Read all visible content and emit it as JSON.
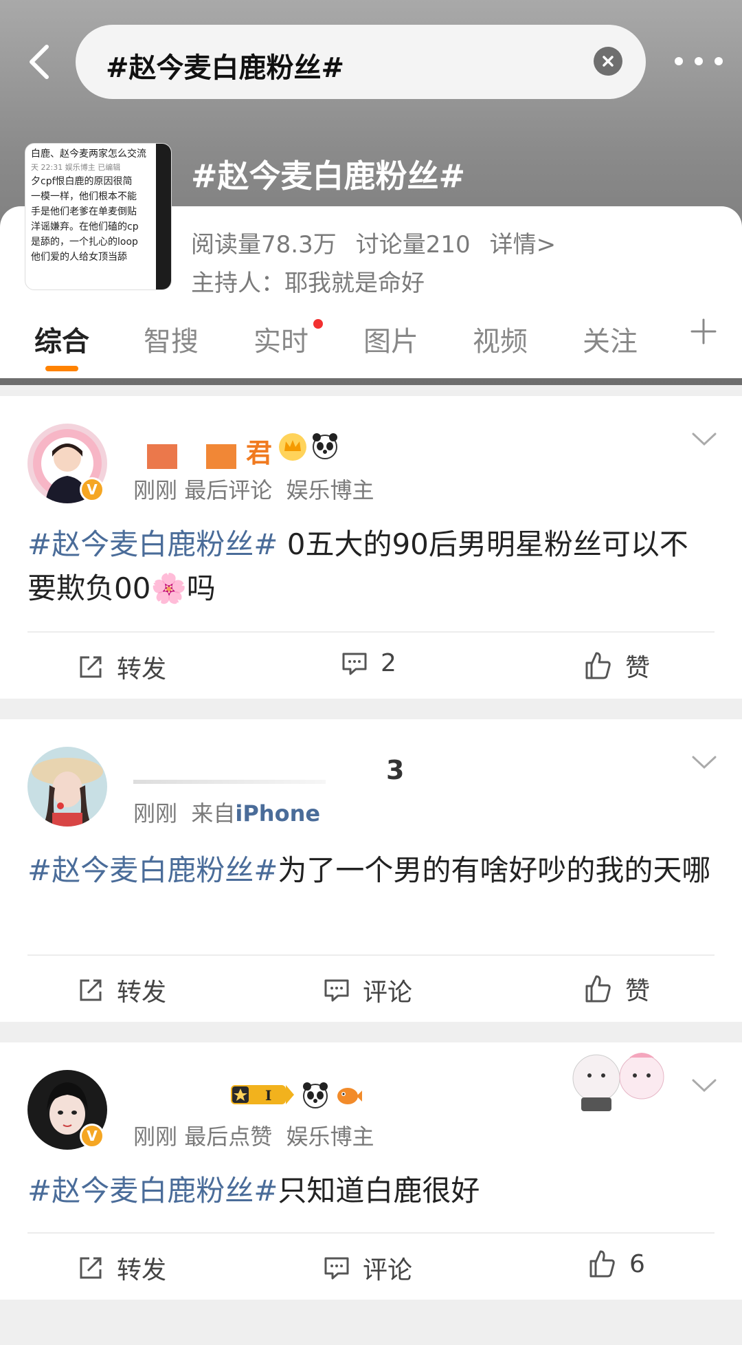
{
  "search": {
    "query": "#赵今麦白鹿粉丝#"
  },
  "topic": {
    "title": "#赵今麦白鹿粉丝#",
    "thumb_lines": [
      "白鹿、赵今麦两家怎么交流",
      "天 22:31  娱乐博主  已编辑",
      "夕cpf恨白鹿的原因很简",
      "一模一样，他们根本不能",
      "手是他们老爹在单麦倒贴",
      "洋谣嫌弃。在他们磕的cp",
      "是舔的，一个扎心的loop",
      "他们爱的人给女顶当舔"
    ],
    "reads": "阅读量78.3万",
    "discussions": "讨论量210",
    "details": "详情>",
    "host": "主持人：耶我就是命好"
  },
  "tabs": [
    {
      "label": "综合",
      "active": true
    },
    {
      "label": "智搜"
    },
    {
      "label": "实时",
      "dot": true
    },
    {
      "label": "图片"
    },
    {
      "label": "视频"
    },
    {
      "label": "关注"
    }
  ],
  "posts": [
    {
      "name_suffix": "君",
      "time": "刚刚",
      "meta": "最后评论",
      "role": "娱乐博主",
      "hashtag": "#赵今麦白鹿粉丝#",
      "text_pre": " 0五大的90后男明星粉丝可以不要欺负00",
      "text_post": "吗",
      "emoji": "🌸",
      "repost": "转发",
      "comment": "2",
      "like": "赞"
    },
    {
      "name_suffix": "3",
      "time": "刚刚",
      "meta_prefix": "来自",
      "source": "iPhone",
      "hashtag": "#赵今麦白鹿粉丝#",
      "text": "为了一个男的有啥好吵的我的天哪",
      "repost": "转发",
      "comment": "评论",
      "like": "赞"
    },
    {
      "time": "刚刚",
      "meta": "最后点赞",
      "role": "娱乐博主",
      "hashtag": "#赵今麦白鹿粉丝#",
      "text": "只知道白鹿很好",
      "badge_level": "I",
      "repost": "转发",
      "comment": "评论",
      "like": "6"
    }
  ],
  "colors": {
    "accent": "#ff8200",
    "link": "#4a6c99",
    "badge": "#f5a623"
  },
  "icons": [
    "back-chevron-icon",
    "clear-icon",
    "more-icon",
    "plus-icon",
    "chevron-down-icon",
    "repost-icon",
    "comment-icon",
    "like-icon",
    "verified-badge-icon",
    "crown-icon",
    "panda-icon",
    "fish-icon",
    "flower-emoji-icon"
  ]
}
